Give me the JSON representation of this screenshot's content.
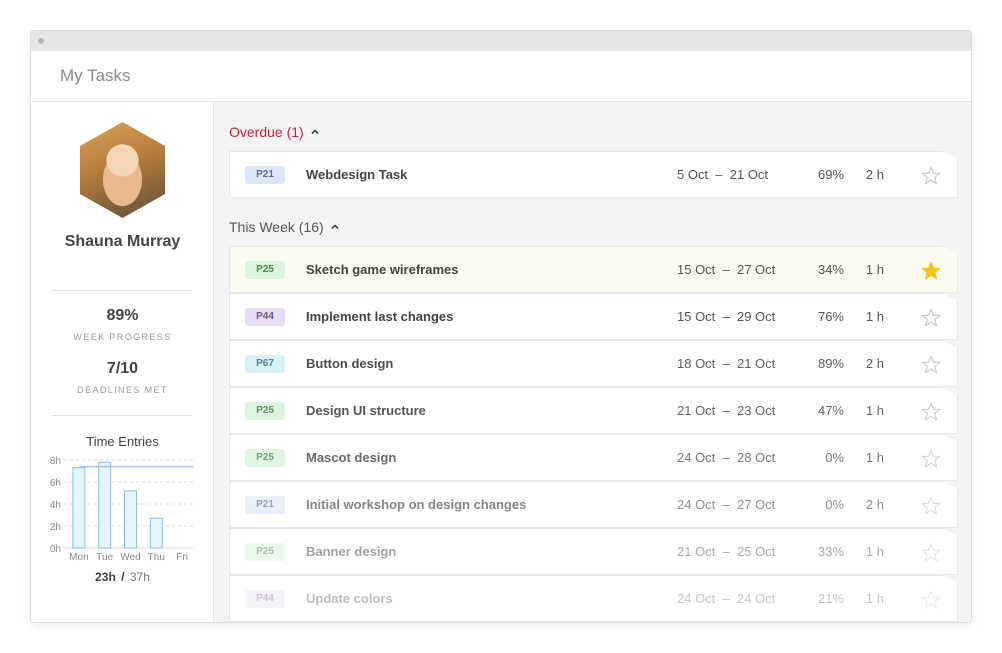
{
  "header": {
    "title": "My Tasks"
  },
  "profile": {
    "name": "Shauna Murray",
    "week_progress_value": "89%",
    "week_progress_label": "WEEK PROGRESS",
    "deadlines_value": "7/10",
    "deadlines_label": "DEADLINES MET"
  },
  "time_entries": {
    "title": "Time Entries",
    "total_done": "23h",
    "total_separator": "/",
    "total_all": "37h",
    "chart_data": {
      "type": "bar",
      "title": "Time Entries",
      "categories": [
        "Mon",
        "Tue",
        "Wed",
        "Thu",
        "Fri"
      ],
      "values": [
        7.3,
        7.8,
        5.2,
        2.7,
        0
      ],
      "target": 7.4,
      "y_ticks": [
        "0h",
        "2h",
        "4h",
        "6h",
        "8h"
      ],
      "ylim": [
        0,
        8
      ],
      "grid": true
    }
  },
  "sections": {
    "overdue": {
      "label": "Overdue",
      "count": "(1)"
    },
    "week": {
      "label": "This Week",
      "count": "(16)"
    }
  },
  "colors": {
    "overdue": "#d4213c",
    "star_active": "#f5c518",
    "star_inactive": "#c9c9c9"
  },
  "overdue_tasks": [
    {
      "project": "P21",
      "badge_bg": "#dce8f8",
      "badge_fg": "#5a6f8f",
      "title": "Webdesign Task",
      "dates": "5 Oct  –  21 Oct",
      "progress": "69%",
      "hours": "2 h",
      "starred": false,
      "opacity": 1
    }
  ],
  "week_tasks": [
    {
      "project": "P25",
      "badge_bg": "#d9f5dc",
      "badge_fg": "#4f8a55",
      "title": "Sketch game wireframes",
      "dates": "15 Oct  –  27 Oct",
      "progress": "34%",
      "hours": "1 h",
      "starred": true,
      "highlight": true,
      "opacity": 1
    },
    {
      "project": "P44",
      "badge_bg": "#e7dcf3",
      "badge_fg": "#6e5b8a",
      "title": "Implement last changes",
      "dates": "15 Oct  –  29 Oct",
      "progress": "76%",
      "hours": "1 h",
      "starred": false,
      "opacity": 1
    },
    {
      "project": "P67",
      "badge_bg": "#d6f0f8",
      "badge_fg": "#4e7f8e",
      "title": "Button design",
      "dates": "18 Oct  –  21 Oct",
      "progress": "89%",
      "hours": "2 h",
      "starred": false,
      "opacity": 0.95
    },
    {
      "project": "P25",
      "badge_bg": "#d9f5dc",
      "badge_fg": "#4f8a55",
      "title": "Design UI structure",
      "dates": "21 Oct  –  23 Oct",
      "progress": "47%",
      "hours": "1 h",
      "starred": false,
      "opacity": 0.9
    },
    {
      "project": "P25",
      "badge_bg": "#d9f5dc",
      "badge_fg": "#4f8a55",
      "title": "Mascot design",
      "dates": "24 Oct  –  28 Oct",
      "progress": "0%",
      "hours": "1 h",
      "starred": false,
      "opacity": 0.8
    },
    {
      "project": "P21",
      "badge_bg": "#dce8f8",
      "badge_fg": "#5a6f8f",
      "title": "Initial workshop on design changes",
      "dates": "24 Oct  –  27 Oct",
      "progress": "0%",
      "hours": "2 h",
      "starred": false,
      "opacity": 0.65
    },
    {
      "project": "P25",
      "badge_bg": "#d9f5dc",
      "badge_fg": "#4f8a55",
      "title": "Banner design",
      "dates": "21 Oct  –  25 Oct",
      "progress": "33%",
      "hours": "1 h",
      "starred": false,
      "opacity": 0.5
    },
    {
      "project": "P44",
      "badge_bg": "#e7dcf3",
      "badge_fg": "#6e5b8a",
      "title": "Update colors",
      "dates": "24 Oct  –  24 Oct",
      "progress": "21%",
      "hours": "1 h",
      "starred": false,
      "opacity": 0.35
    }
  ]
}
